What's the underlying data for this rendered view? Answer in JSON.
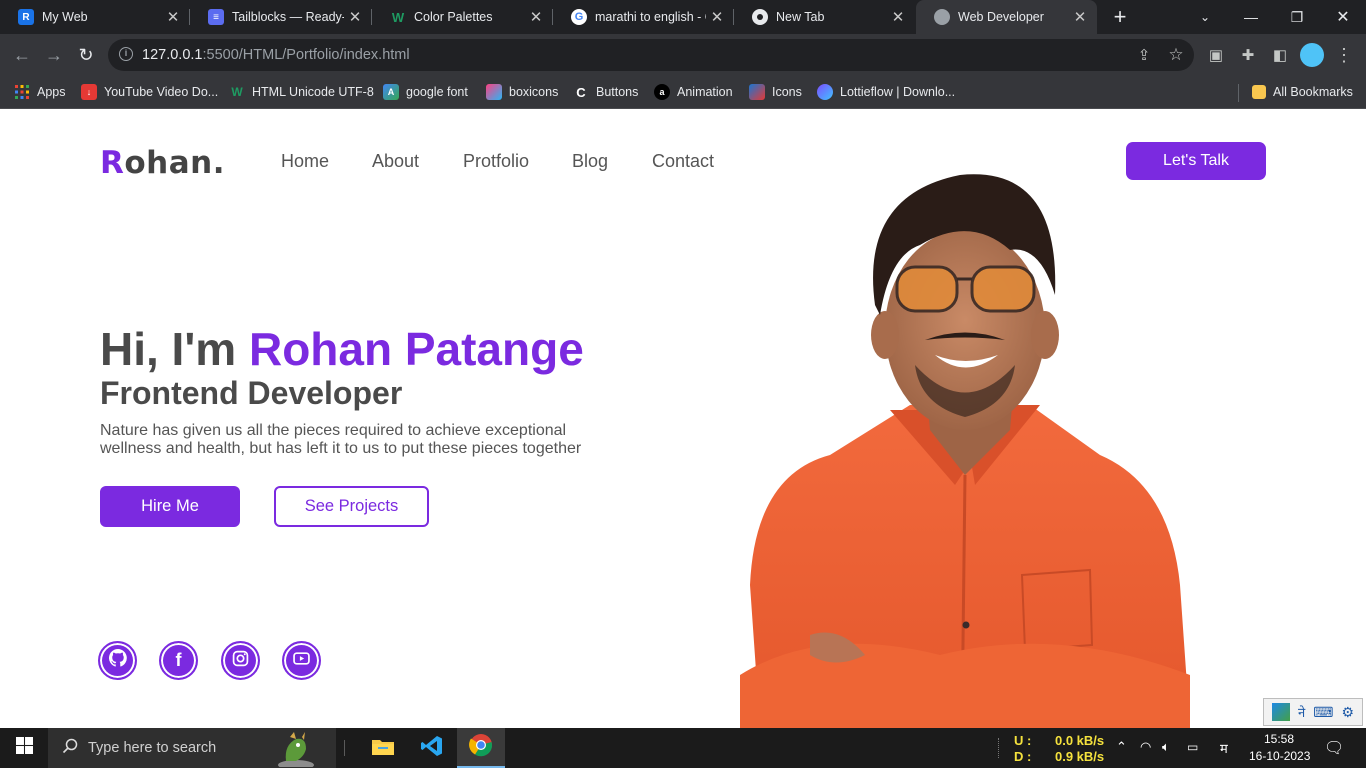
{
  "browser": {
    "tabs": [
      {
        "title": "My Web",
        "favicon_color": "#1a73e8",
        "favicon_glyph": "R"
      },
      {
        "title": "Tailblocks — Ready-to",
        "favicon_color": "#5b6cf0",
        "favicon_glyph": "≡"
      },
      {
        "title": "Color Palettes",
        "favicon_color": "#0b7a4b",
        "favicon_glyph": "W"
      },
      {
        "title": "marathi to english - G",
        "favicon_color": "#ffffff",
        "favicon_glyph": "G"
      },
      {
        "title": "New Tab",
        "favicon_color": "#9aa0a6",
        "favicon_glyph": "◎"
      },
      {
        "title": "Web Developer",
        "favicon_color": "#9aa0a6",
        "favicon_glyph": "◍"
      }
    ],
    "url_host": "127.0.0.1",
    "url_rest": ":5500/HTML/Portfolio/index.html",
    "bookmarks": [
      {
        "label": "Apps",
        "icon": "apps-grid-icon"
      },
      {
        "label": "YouTube Video Do...",
        "icon": "download-icon"
      },
      {
        "label": "HTML Unicode UTF-8",
        "icon": "w-icon"
      },
      {
        "label": "google font",
        "icon": "google-fonts-icon"
      },
      {
        "label": "boxicons",
        "icon": "boxicons-icon"
      },
      {
        "label": "Buttons",
        "icon": "c-icon"
      },
      {
        "label": "Animation",
        "icon": "a-icon"
      },
      {
        "label": "Icons",
        "icon": "flaticon-icon"
      },
      {
        "label": "Lottieflow | Downlo...",
        "icon": "lottie-icon"
      }
    ],
    "all_bookmarks": "All Bookmarks"
  },
  "site": {
    "logo_first": "R",
    "logo_rest": "ohan",
    "logo_dot": ".",
    "nav": [
      "Home",
      "About",
      "Protfolio",
      "Blog",
      "Contact"
    ],
    "cta": "Let's Talk",
    "greeting": "Hi, I'm ",
    "name": "Rohan Patange",
    "role": "Frontend Developer",
    "description": "Nature has given us all the pieces required to achieve exceptional wellness and health, but has left it to us to put these pieces together",
    "hire_button": "Hire Me",
    "projects_button": "See Projects",
    "socials": [
      "github-icon",
      "facebook-icon",
      "instagram-icon",
      "youtube-icon"
    ],
    "accent_color": "#7b2ae0"
  },
  "ime": {
    "label": "ने"
  },
  "taskbar": {
    "search_placeholder": "Type here to search",
    "net_up_label": "U :",
    "net_down_label": "D :",
    "net_up": "0.0 kB/s",
    "net_down": "0.9 kB/s",
    "lang": "म",
    "time": "15:58",
    "date": "16-10-2023"
  }
}
